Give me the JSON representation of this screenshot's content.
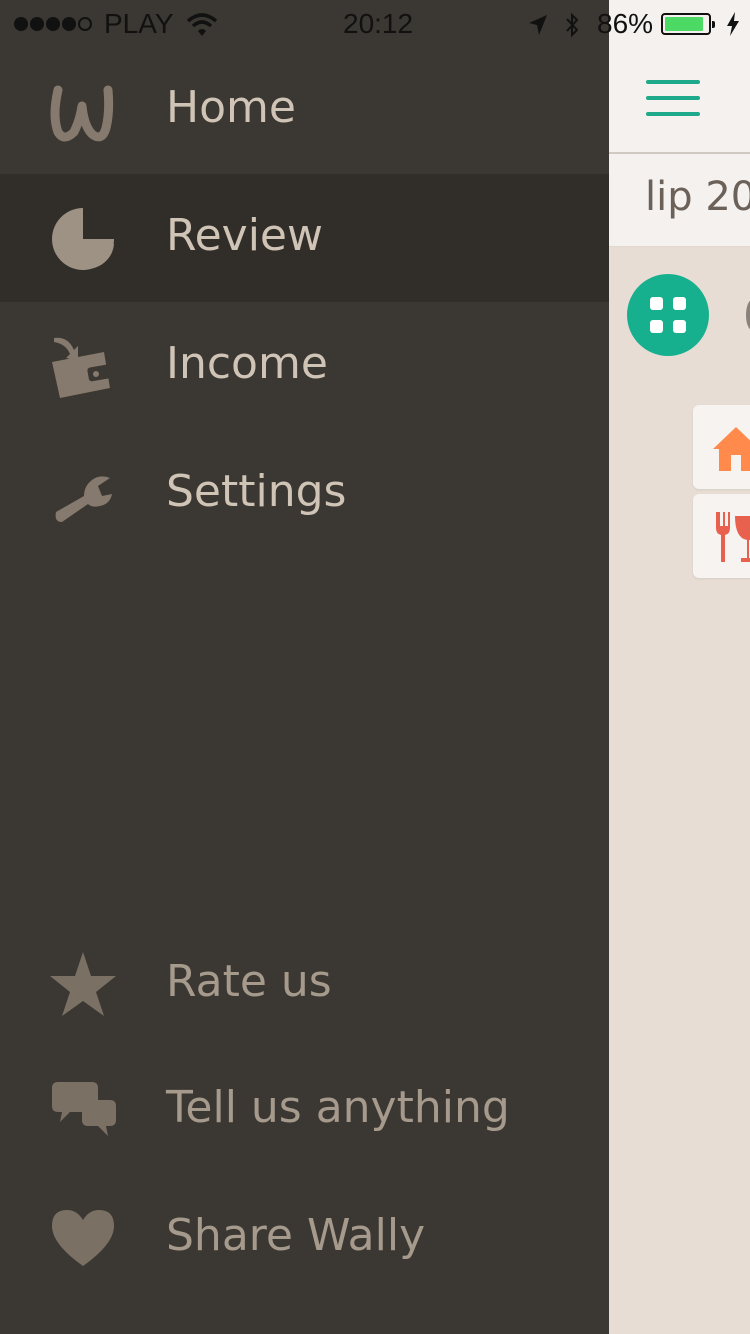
{
  "status_bar": {
    "carrier": "PLAY",
    "time": "20:12",
    "battery": "86%",
    "icons": [
      "signal-dots-icon",
      "wifi-icon",
      "location-arrow-icon",
      "bluetooth-icon",
      "battery-icon",
      "charging-bolt-icon"
    ]
  },
  "drawer": {
    "items": [
      {
        "label": "Home",
        "icon": "wally-logo-icon"
      },
      {
        "label": "Review",
        "icon": "pie-chart-icon",
        "active": true
      },
      {
        "label": "Income",
        "icon": "wallet-income-icon"
      },
      {
        "label": "Settings",
        "icon": "wrench-icon"
      }
    ],
    "secondary_items": [
      {
        "label": "Rate us",
        "icon": "star-icon"
      },
      {
        "label": "Tell us anything",
        "icon": "chat-bubbles-icon"
      },
      {
        "label": "Share Wally",
        "icon": "heart-icon"
      }
    ]
  },
  "content": {
    "month_label": "lip 20",
    "icons": [
      "hamburger-menu-icon",
      "grid-view-icon",
      "house-category-icon",
      "dining-category-icon"
    ]
  },
  "colors": {
    "drawer_bg": "#3b3732",
    "drawer_active_bg": "#312e2a",
    "accent_green": "#17b08f",
    "battery_green": "#4cd964",
    "house_orange": "#ff8a4c",
    "dining_red": "#e8604e"
  }
}
